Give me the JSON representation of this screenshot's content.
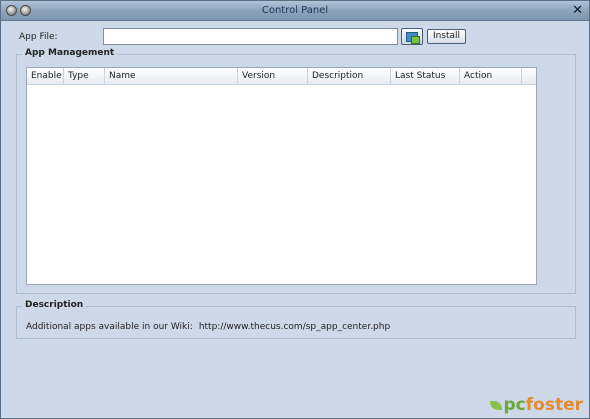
{
  "window": {
    "title": "Control Panel",
    "close_glyph": "✕"
  },
  "app_file": {
    "label": "App File:",
    "value": "",
    "placeholder": "",
    "install_label": "Install"
  },
  "app_management": {
    "legend": "App Management",
    "columns": [
      "Enable",
      "Type",
      "Name",
      "Version",
      "Description",
      "Last Status",
      "Action"
    ],
    "rows": []
  },
  "description": {
    "legend": "Description",
    "text": "Additional apps available in our Wiki:",
    "url": "http://www.thecus.com/sp_app_center.php"
  },
  "watermark": {
    "prefix": "pc",
    "suffix": "foster"
  },
  "icons": {
    "browse": "browse-file-icon",
    "close": "close-icon"
  },
  "colors": {
    "window_bg": "#cdd9e8",
    "titlebar": "#8ea4bd",
    "logo_orange": "#e48b2e",
    "logo_green": "#6aa83a"
  }
}
